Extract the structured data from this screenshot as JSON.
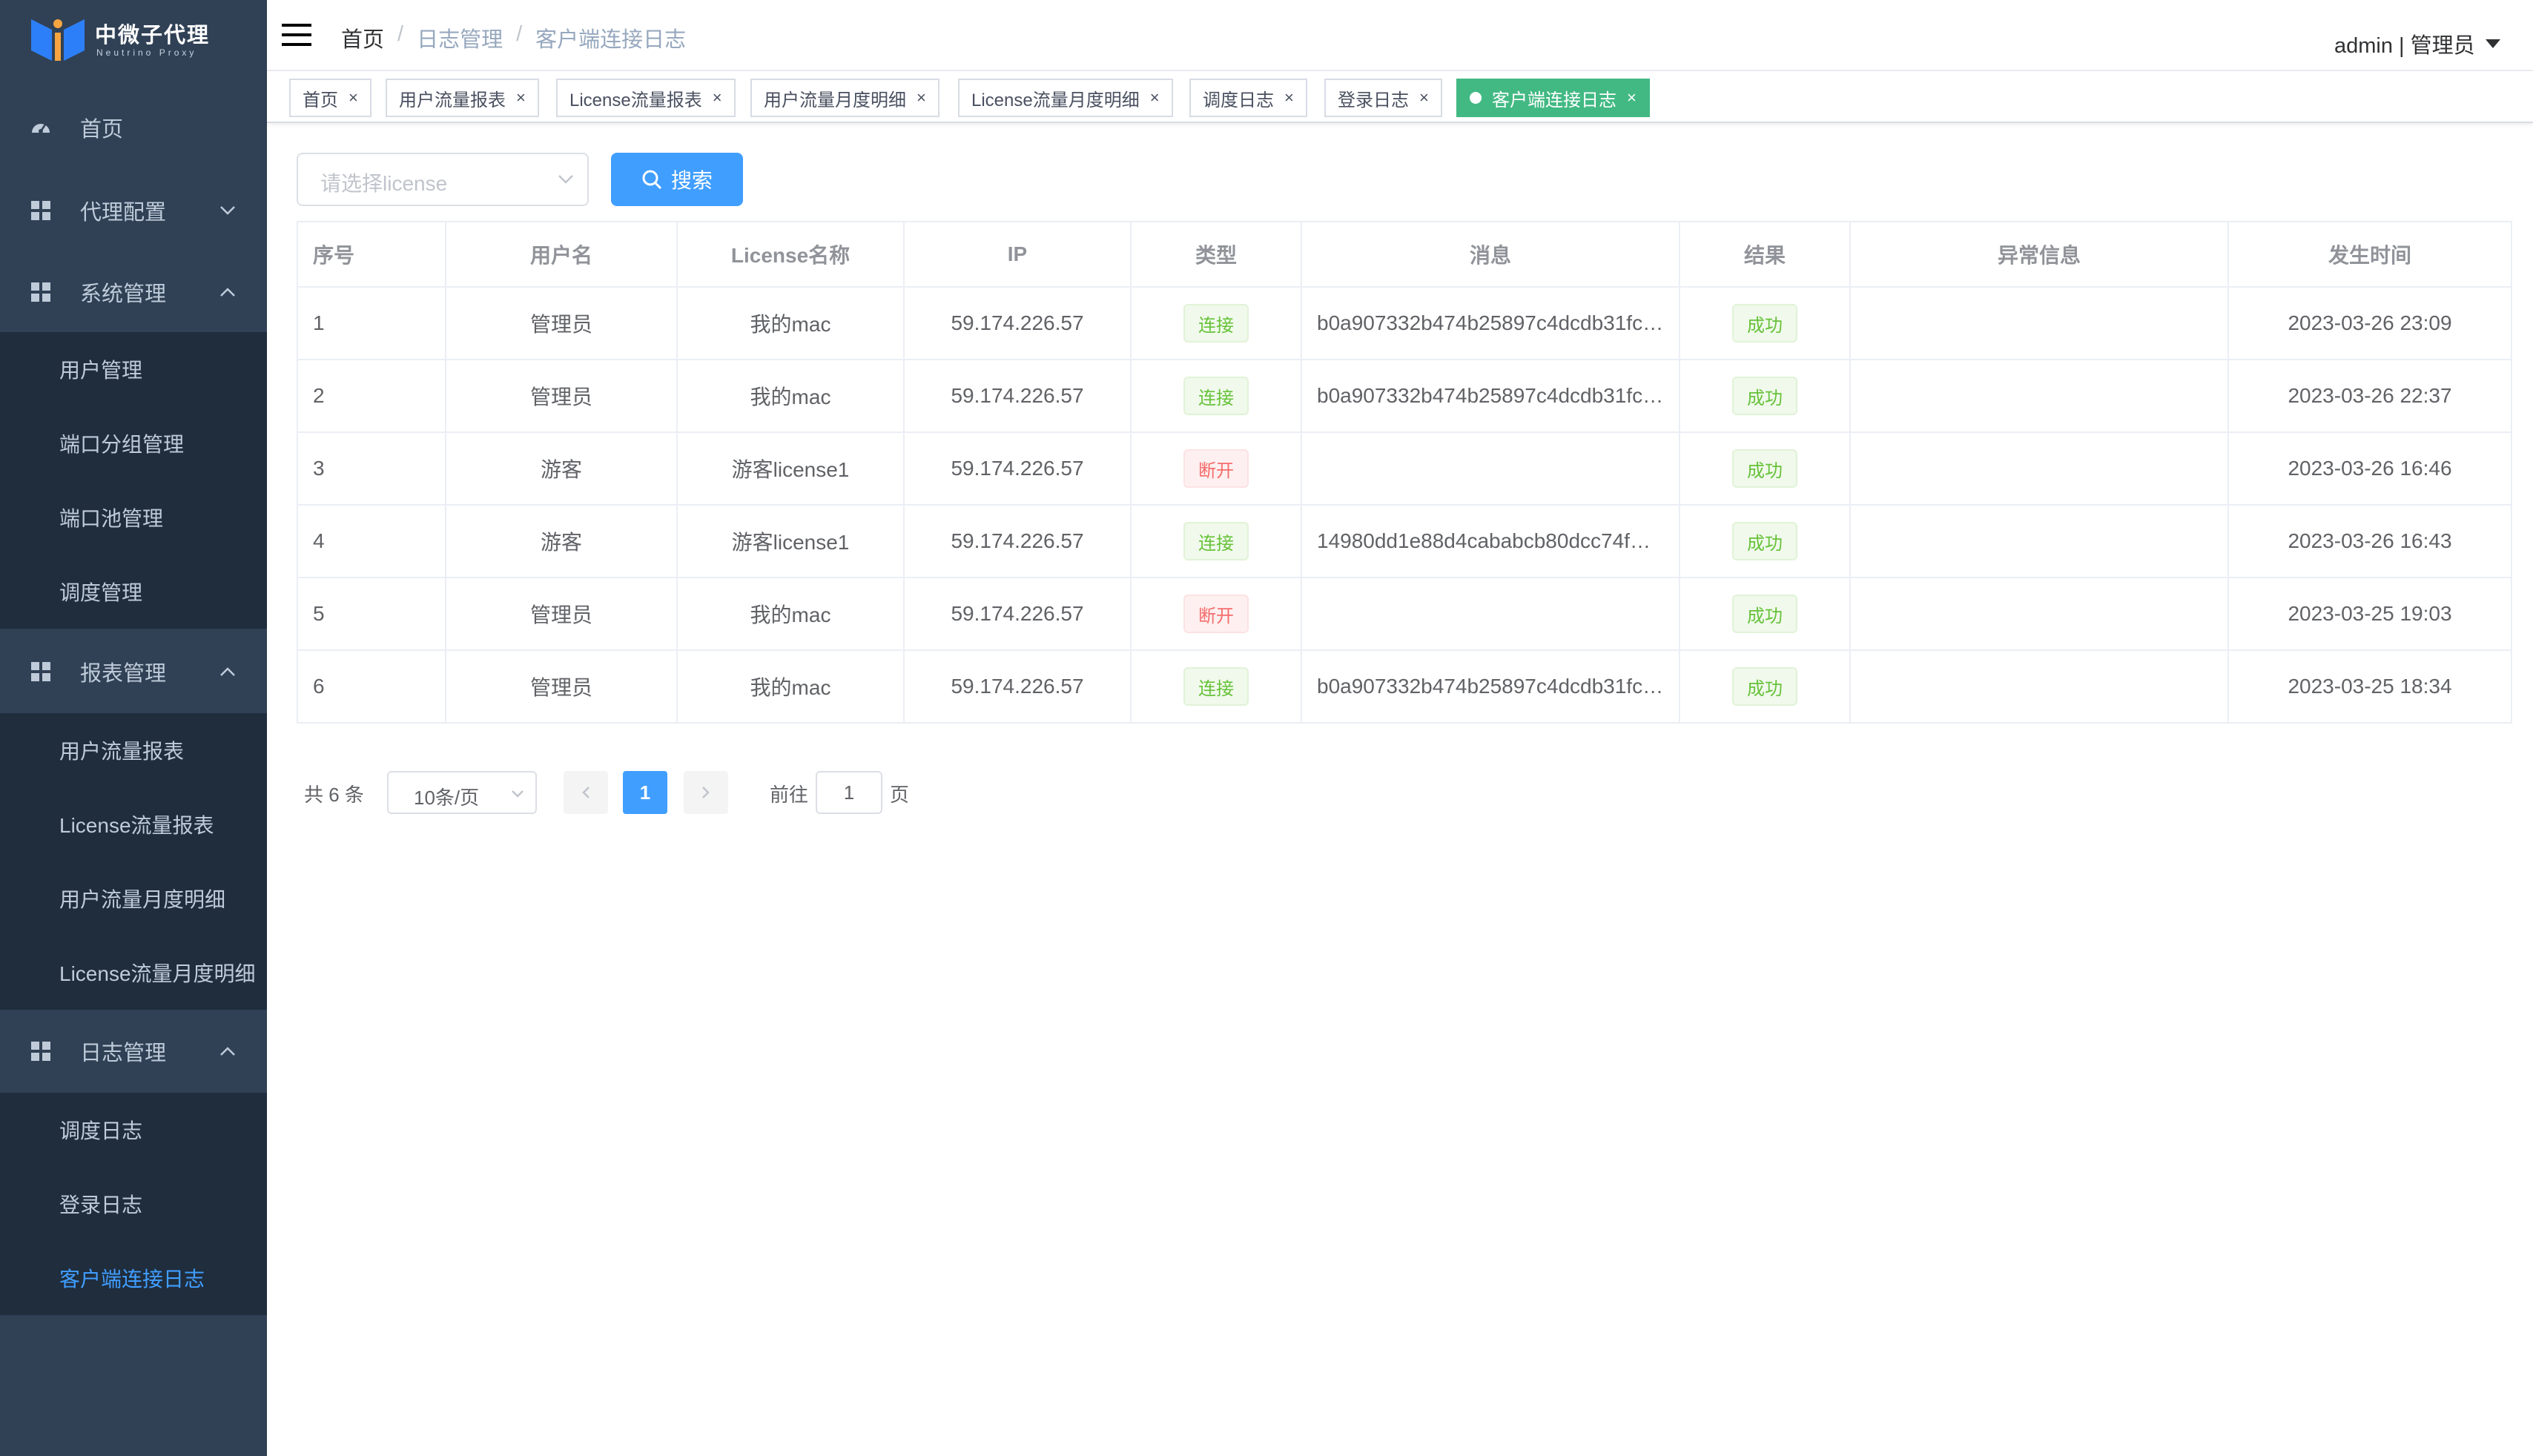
{
  "brand": {
    "title": "中微子代理",
    "subtitle": "Neutrino Proxy"
  },
  "sidebar": {
    "home": "首页",
    "proxy_config": "代理配置",
    "system": {
      "label": "系统管理",
      "items": [
        "用户管理",
        "端口分组管理",
        "端口池管理",
        "调度管理"
      ]
    },
    "reports": {
      "label": "报表管理",
      "items": [
        "用户流量报表",
        "License流量报表",
        "用户流量月度明细",
        "License流量月度明细"
      ]
    },
    "logs": {
      "label": "日志管理",
      "items": [
        "调度日志",
        "登录日志",
        "客户端连接日志"
      ]
    }
  },
  "header": {
    "breadcrumb": [
      "首页",
      "日志管理",
      "客户端连接日志"
    ],
    "user": "admin | 管理员"
  },
  "tags": [
    "首页",
    "用户流量报表",
    "License流量报表",
    "用户流量月度明细",
    "License流量月度明细",
    "调度日志",
    "登录日志",
    "客户端连接日志"
  ],
  "filter": {
    "placeholder": "请选择license",
    "search_label": "搜索"
  },
  "table": {
    "columns": [
      "序号",
      "用户名",
      "License名称",
      "IP",
      "类型",
      "消息",
      "结果",
      "异常信息",
      "发生时间"
    ],
    "rows": [
      {
        "no": "1",
        "user": "管理员",
        "license": "我的mac",
        "ip": "59.174.226.57",
        "type": "连接",
        "type_status": "success",
        "message": "b0a907332b474b25897c4dcdb31fc…",
        "result": "成功",
        "error": "",
        "time": "2023-03-26 23:09"
      },
      {
        "no": "2",
        "user": "管理员",
        "license": "我的mac",
        "ip": "59.174.226.57",
        "type": "连接",
        "type_status": "success",
        "message": "b0a907332b474b25897c4dcdb31fc…",
        "result": "成功",
        "error": "",
        "time": "2023-03-26 22:37"
      },
      {
        "no": "3",
        "user": "游客",
        "license": "游客license1",
        "ip": "59.174.226.57",
        "type": "断开",
        "type_status": "danger",
        "message": "",
        "result": "成功",
        "error": "",
        "time": "2023-03-26 16:46"
      },
      {
        "no": "4",
        "user": "游客",
        "license": "游客license1",
        "ip": "59.174.226.57",
        "type": "连接",
        "type_status": "success",
        "message": "14980dd1e88d4cababcb80dcc74f…",
        "result": "成功",
        "error": "",
        "time": "2023-03-26 16:43"
      },
      {
        "no": "5",
        "user": "管理员",
        "license": "我的mac",
        "ip": "59.174.226.57",
        "type": "断开",
        "type_status": "danger",
        "message": "",
        "result": "成功",
        "error": "",
        "time": "2023-03-25 19:03"
      },
      {
        "no": "6",
        "user": "管理员",
        "license": "我的mac",
        "ip": "59.174.226.57",
        "type": "连接",
        "type_status": "success",
        "message": "b0a907332b474b25897c4dcdb31fc…",
        "result": "成功",
        "error": "",
        "time": "2023-03-25 18:34"
      }
    ]
  },
  "pagination": {
    "total": "共 6 条",
    "page_size": "10条/页",
    "current": "1",
    "goto": "前往",
    "goto_value": "1",
    "unit": "页"
  },
  "colors": {
    "sidebar_bg": "#304156",
    "submenu_bg": "#1f2d3d",
    "primary": "#409eff",
    "active_tag": "#42b983",
    "success": "#67c23a",
    "danger": "#f56c6c"
  },
  "icons": {
    "dashboard": "dashboard-icon",
    "grid": "grid-icon",
    "menu": "hamburger-icon",
    "search": "search-icon"
  }
}
